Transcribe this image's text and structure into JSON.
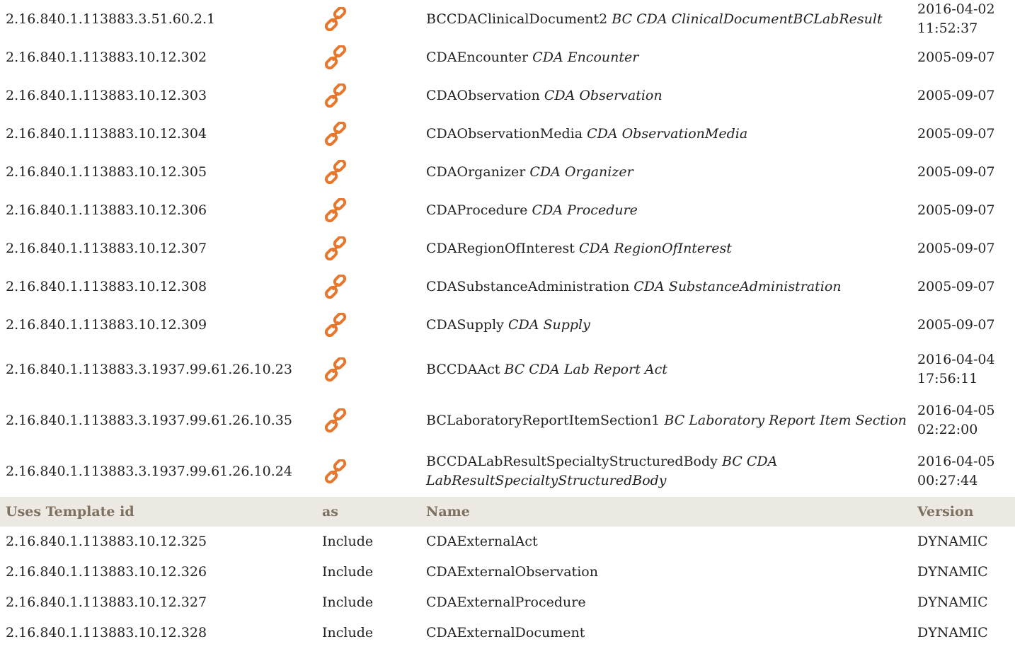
{
  "rows": [
    {
      "id": "2.16.840.1.113883.3.51.60.2.1",
      "name": "BCCDAClinicalDocument2",
      "desc": "BC CDA ClinicalDocumentBCLabResult",
      "date": "2016-04-02",
      "time": "11:52:37"
    },
    {
      "id": "2.16.840.1.113883.10.12.302",
      "name": "CDAEncounter",
      "desc": "CDA Encounter",
      "date": "2005-09-07",
      "time": ""
    },
    {
      "id": "2.16.840.1.113883.10.12.303",
      "name": "CDAObservation",
      "desc": "CDA Observation",
      "date": "2005-09-07",
      "time": ""
    },
    {
      "id": "2.16.840.1.113883.10.12.304",
      "name": "CDAObservationMedia",
      "desc": "CDA ObservationMedia",
      "date": "2005-09-07",
      "time": ""
    },
    {
      "id": "2.16.840.1.113883.10.12.305",
      "name": "CDAOrganizer",
      "desc": "CDA Organizer",
      "date": "2005-09-07",
      "time": ""
    },
    {
      "id": "2.16.840.1.113883.10.12.306",
      "name": "CDAProcedure",
      "desc": "CDA Procedure",
      "date": "2005-09-07",
      "time": ""
    },
    {
      "id": "2.16.840.1.113883.10.12.307",
      "name": "CDARegionOfInterest",
      "desc": "CDA RegionOfInterest",
      "date": "2005-09-07",
      "time": ""
    },
    {
      "id": "2.16.840.1.113883.10.12.308",
      "name": "CDASubstanceAdministration",
      "desc": "CDA SubstanceAdministration",
      "date": "2005-09-07",
      "time": ""
    },
    {
      "id": "2.16.840.1.113883.10.12.309",
      "name": "CDASupply",
      "desc": "CDA Supply",
      "date": "2005-09-07",
      "time": ""
    },
    {
      "id": "2.16.840.1.113883.3.1937.99.61.26.10.23",
      "name": "BCCDAAct",
      "desc": "BC CDA Lab Report Act",
      "date": "2016-04-04",
      "time": "17:56:11"
    },
    {
      "id": "2.16.840.1.113883.3.1937.99.61.26.10.35",
      "name": "BCLaboratoryReportItemSection1",
      "desc": "BC Laboratory Report Item Section",
      "date": "2016-04-05",
      "time": "02:22:00"
    },
    {
      "id": "2.16.840.1.113883.3.1937.99.61.26.10.24",
      "name": "BCCDALabResultSpecialtyStructuredBody",
      "desc": "BC CDA LabResultSpecialtyStructuredBody",
      "date": "2016-04-05",
      "time": "00:27:44"
    }
  ],
  "uses_header": {
    "template_id": "Uses Template id",
    "as": "as",
    "name": "Name",
    "version": "Version"
  },
  "uses": [
    {
      "id": "2.16.840.1.113883.10.12.325",
      "as": "Include",
      "name": "CDAExternalAct",
      "version": "DYNAMIC"
    },
    {
      "id": "2.16.840.1.113883.10.12.326",
      "as": "Include",
      "name": "CDAExternalObservation",
      "version": "DYNAMIC"
    },
    {
      "id": "2.16.840.1.113883.10.12.327",
      "as": "Include",
      "name": "CDAExternalProcedure",
      "version": "DYNAMIC"
    },
    {
      "id": "2.16.840.1.113883.10.12.328",
      "as": "Include",
      "name": "CDAExternalDocument",
      "version": "DYNAMIC"
    }
  ],
  "link_icon": "chain-link-icon",
  "colors": {
    "link_icon": "#e8772e",
    "header_bg": "#ece9e3",
    "header_text": "#7f7160",
    "text": "#222222"
  }
}
